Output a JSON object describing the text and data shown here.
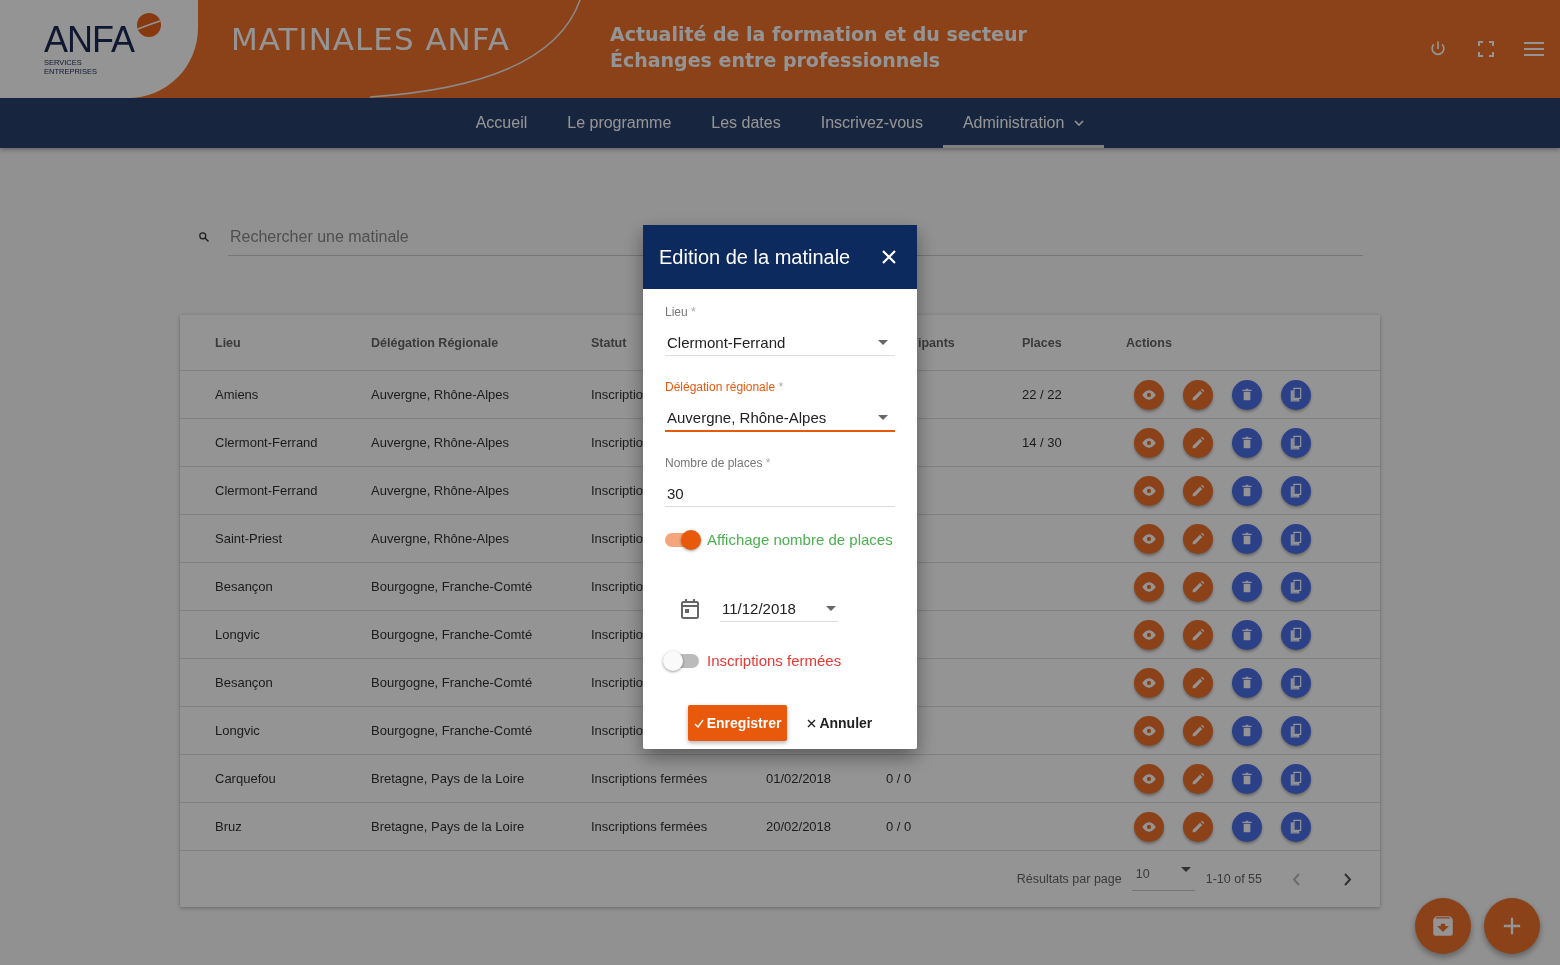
{
  "header": {
    "logo": {
      "name": "ANFA",
      "subtitle": [
        "SERVICES",
        "ENTREPRISES"
      ]
    },
    "title": "MATINALES ANFA",
    "taglines": [
      "Actualité de la formation et du secteur",
      "Échanges entre professionnels"
    ]
  },
  "nav": [
    {
      "label": "Accueil",
      "selected": false,
      "dropdown": false
    },
    {
      "label": "Le programme",
      "selected": false,
      "dropdown": false
    },
    {
      "label": "Les dates",
      "selected": false,
      "dropdown": false
    },
    {
      "label": "Inscrivez-vous",
      "selected": false,
      "dropdown": false
    },
    {
      "label": "Administration",
      "selected": true,
      "dropdown": true
    }
  ],
  "search": {
    "placeholder": "Rechercher une matinale"
  },
  "table": {
    "columns": [
      "Lieu",
      "Délégation Régionale",
      "Statut",
      "",
      "ipants",
      "Places",
      "Actions"
    ],
    "rows": [
      {
        "cells": [
          "Amiens",
          "Auvergne, Rhône-Alpes",
          "Inscriptio",
          "",
          "",
          "22 / 22"
        ]
      },
      {
        "cells": [
          "Clermont-Ferrand",
          "Auvergne, Rhône-Alpes",
          "Inscriptio",
          "",
          "",
          "14 / 30"
        ]
      },
      {
        "cells": [
          "Clermont-Ferrand",
          "Auvergne, Rhône-Alpes",
          "Inscriptio",
          "",
          "",
          ""
        ]
      },
      {
        "cells": [
          "Saint-Priest",
          "Auvergne, Rhône-Alpes",
          "Inscriptio",
          "",
          "",
          ""
        ]
      },
      {
        "cells": [
          "Besançon",
          "Bourgogne, Franche-Comté",
          "Inscriptio",
          "",
          "",
          ""
        ]
      },
      {
        "cells": [
          "Longvic",
          "Bourgogne, Franche-Comté",
          "Inscriptio",
          "",
          "",
          ""
        ]
      },
      {
        "cells": [
          "Besançon",
          "Bourgogne, Franche-Comté",
          "Inscriptio",
          "",
          "",
          ""
        ]
      },
      {
        "cells": [
          "Longvic",
          "Bourgogne, Franche-Comté",
          "Inscriptio",
          "",
          "",
          ""
        ]
      },
      {
        "cells": [
          "Carquefou",
          "Bretagne, Pays de la Loire",
          "Inscriptions fermées",
          "01/02/2018",
          "0 / 0",
          ""
        ]
      },
      {
        "cells": [
          "Bruz",
          "Bretagne, Pays de la Loire",
          "Inscriptions fermées",
          "20/02/2018",
          "0 / 0",
          ""
        ]
      }
    ],
    "pagination": {
      "label": "Résultats par page",
      "per_page": "10",
      "range": "1-10 of 55",
      "prev_disabled": true
    }
  },
  "dialog": {
    "title": "Edition de la matinale",
    "fields": [
      {
        "kind": "select",
        "label": "Lieu",
        "required_mark": "*",
        "value": "Clermont-Ferrand",
        "focused": false
      },
      {
        "kind": "select",
        "label": "Délégation régionale",
        "required_mark": "*",
        "value": "Auvergne, Rhône-Alpes",
        "focused": true
      },
      {
        "kind": "text",
        "label": "Nombre de places",
        "required_mark": "*",
        "value": "30",
        "focused": false
      },
      {
        "kind": "toggle",
        "label": "Affichage nombre de places",
        "checked": true
      },
      {
        "kind": "date",
        "value": "11/12/2018"
      },
      {
        "kind": "toggle",
        "label": "Inscriptions fermées",
        "checked": false
      }
    ],
    "buttons": [
      {
        "kind": "primary",
        "label": "Enregistrer"
      },
      {
        "kind": "flat",
        "label": "Annuler"
      }
    ]
  }
}
